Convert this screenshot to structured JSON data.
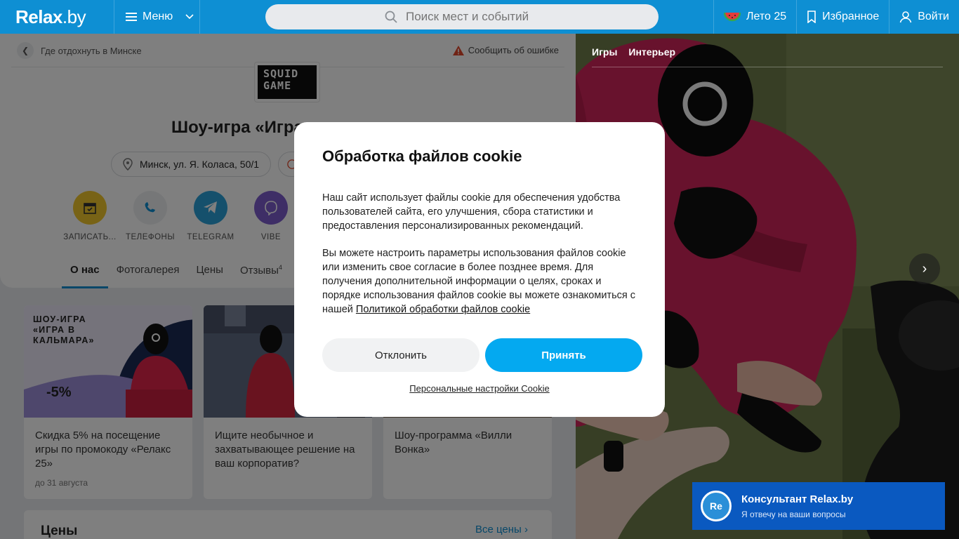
{
  "header": {
    "logo_main": "Relax",
    "logo_suffix": ".by",
    "menu_label": "Меню",
    "search_placeholder": "Поиск мест и событий",
    "summer_label": "Лето 25",
    "favorites_label": "Избранное",
    "login_label": "Войти"
  },
  "breadcrumb": {
    "label": "Где отдохнуть в Минске"
  },
  "report_label": "Сообщить об ошибке",
  "venue": {
    "logo_line1": "SQUID",
    "logo_line2": "GAME",
    "title": "Шоу-игра «Игра",
    "address": "Минск, ул. Я. Коласа, 50/1"
  },
  "actions": [
    {
      "label": "ЗАПИСАТЬ...",
      "icon": "calendar-icon",
      "color": "#f0c62c"
    },
    {
      "label": "ТЕЛЕФОНЫ",
      "icon": "phone-icon",
      "color": "#eceef0"
    },
    {
      "label": "TELEGRAM",
      "icon": "telegram-icon",
      "color": "#2aa0d8"
    },
    {
      "label": "VIBE",
      "icon": "viber-icon",
      "color": "#7d5ccc"
    }
  ],
  "tabs": [
    {
      "label": "О нас"
    },
    {
      "label": "Фотогалерея"
    },
    {
      "label": "Цены"
    },
    {
      "label": "Отзывы",
      "count": "4"
    }
  ],
  "promos": [
    {
      "badge_title": "ШОУ-ИГРА «ИГРА В КАЛЬМАРА»",
      "discount": "-5%",
      "text": "Скидка 5% на посещение игры по промокоду «Релакс 25»",
      "date": "до 31 августа"
    },
    {
      "text": "Ищите необычное и захватывающее решение на ваш корпоратив?"
    },
    {
      "text": "Шоу-программа «Вилли Вонка»"
    }
  ],
  "prices": {
    "title": "Цены",
    "all_label": "Все цены"
  },
  "gallery": {
    "tabs": [
      "Игры",
      "Интерьер"
    ]
  },
  "cookie": {
    "title": "Обработка файлов cookie",
    "paragraph1": "Наш сайт использует файлы cookie для обеспечения удобства пользователей сайта, его улучшения, сбора статистики и предоставления персонализированных рекомендаций.",
    "paragraph2": "Вы можете настроить параметры использования файлов cookie или изменить свое согласие в более позднее время. Для получения дополнительной информации о целях, сроках и порядке использования файлов cookie вы можете ознакомиться с нашей ",
    "policy_link": "Политикой обработки файлов cookie",
    "decline_label": "Отклонить",
    "accept_label": "Принять",
    "personal_label": "Персональные настройки Cookie"
  },
  "consultant": {
    "avatar_text": "Re",
    "title": "Консультант Relax.by",
    "subtitle": "Я отвечу на ваши вопросы"
  },
  "colors": {
    "brand": "#0e8fd3",
    "accept": "#04a9f0",
    "consultant": "#0a59c0"
  }
}
